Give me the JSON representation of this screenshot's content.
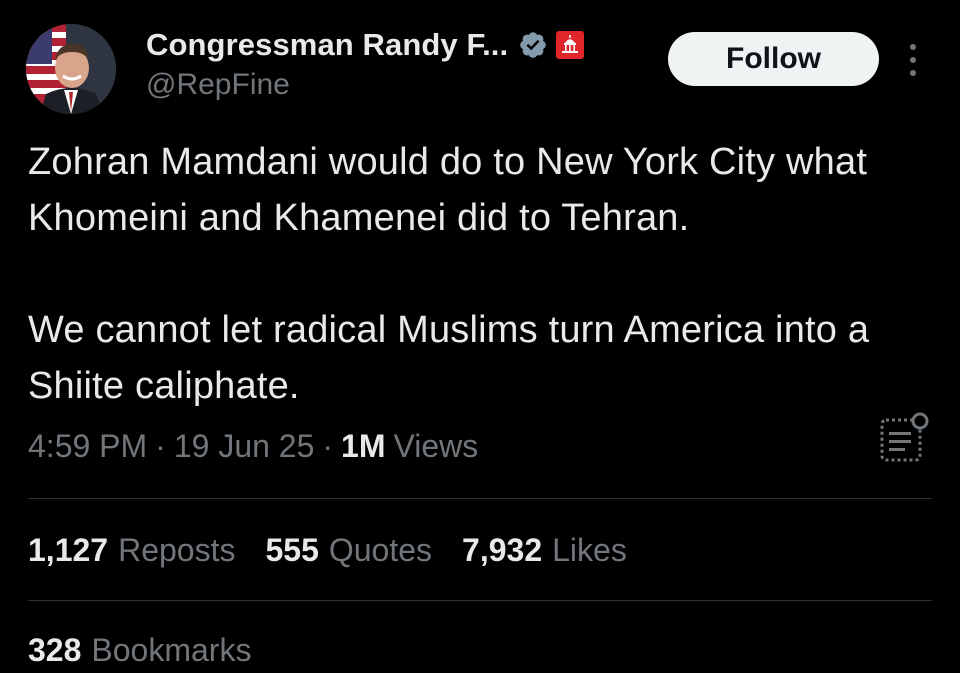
{
  "author": {
    "display_name": "Congressman Randy F...",
    "handle": "@RepFine",
    "verified_icon": "verified-badge-icon",
    "affiliation_icon": "capitol-badge-icon"
  },
  "header": {
    "follow_label": "Follow",
    "more_icon": "more-vertical-icon"
  },
  "tweet": {
    "paragraphs": [
      "Zohran Mamdani would do to New York City what Khomeini and Khamenei did to Tehran.",
      "We cannot let radical Muslims turn America into a Shiite caliphate."
    ]
  },
  "meta": {
    "time": "4:59 PM",
    "date": "19 Jun 25",
    "views_count": "1M",
    "views_label": "Views",
    "separator": "·",
    "summary_icon": "summary-icon"
  },
  "stats": [
    {
      "count": "1,127",
      "label": "Reposts"
    },
    {
      "count": "555",
      "label": "Quotes"
    },
    {
      "count": "7,932",
      "label": "Likes"
    }
  ],
  "bookmarks": {
    "count": "328",
    "label": "Bookmarks"
  },
  "colors": {
    "background": "#000000",
    "text_primary": "#e7e9ea",
    "text_secondary": "#71767b",
    "verified": "#829aab",
    "affiliate_badge": "#e0262b",
    "follow_bg": "#eff3f4",
    "divider": "#2f3336"
  }
}
